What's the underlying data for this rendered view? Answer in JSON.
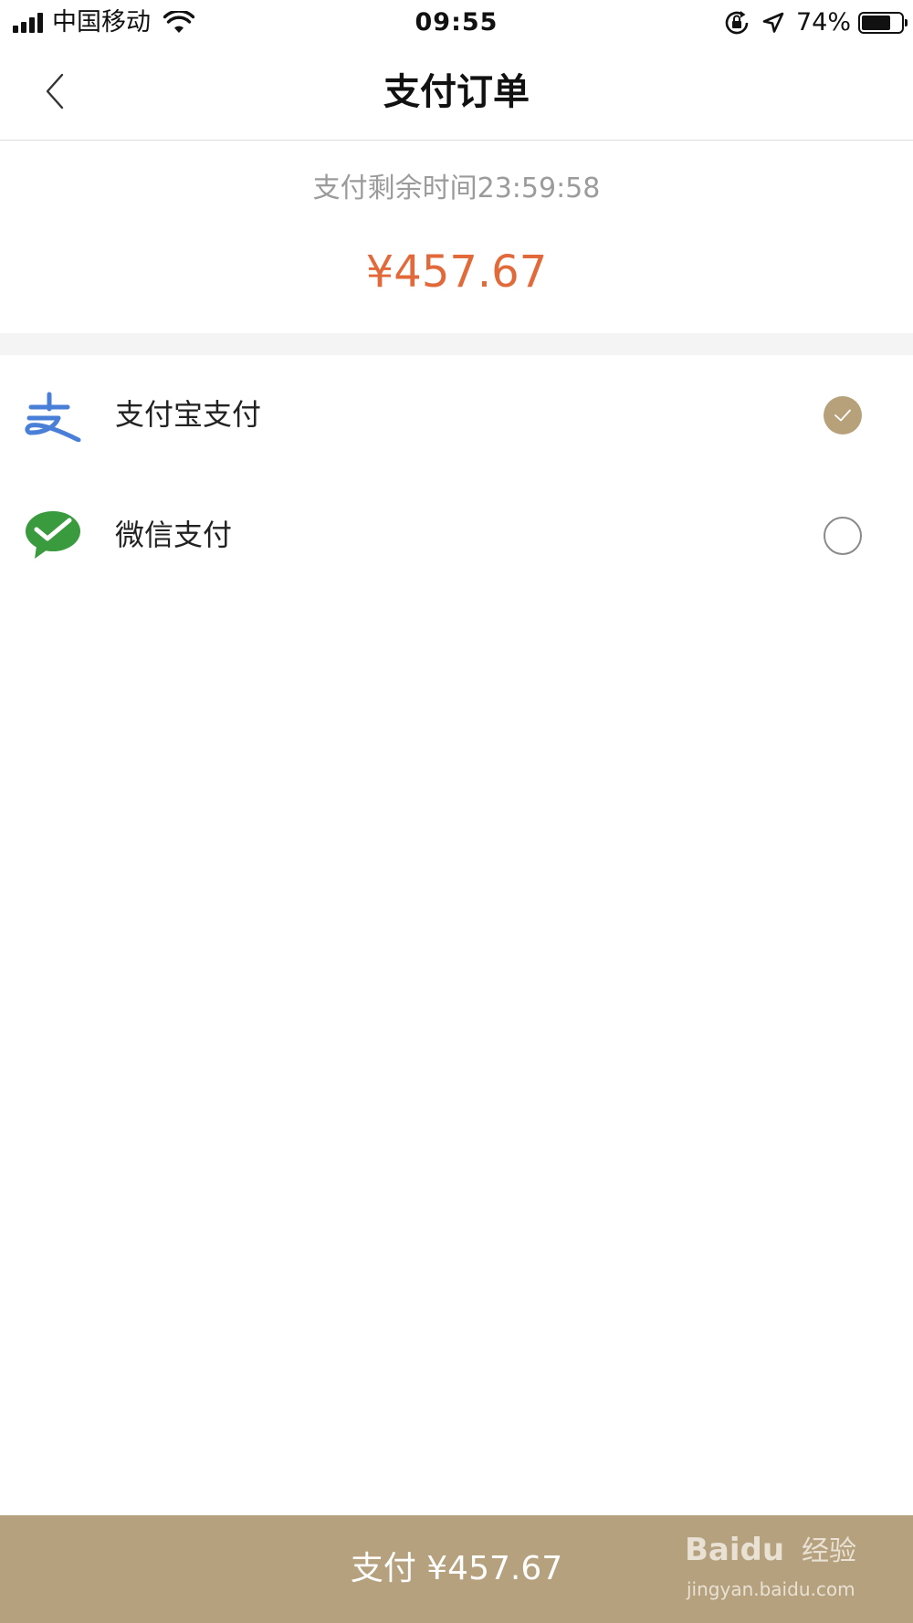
{
  "status_bar": {
    "carrier": "中国移动",
    "time": "09:55",
    "battery_percent_text": "74%",
    "battery_level": 0.74,
    "icons": [
      "signal-icon",
      "wifi-icon",
      "rotation-lock-icon",
      "location-arrow-icon",
      "battery-icon"
    ]
  },
  "nav": {
    "title": "支付订单",
    "back_icon": "chevron-left-icon"
  },
  "order": {
    "countdown": "支付剩余时间23:59:58",
    "amount": "¥457.67"
  },
  "payment_methods": [
    {
      "label": "支付宝支付",
      "icon": "alipay-icon",
      "selected": true
    },
    {
      "label": "微信支付",
      "icon": "wechat-pay-icon",
      "selected": false
    }
  ],
  "pay_button": {
    "label": "支付 ¥457.67"
  },
  "watermark": {
    "brand": "Baidu",
    "brand_cn": "经验",
    "url": "jingyan.baidu.com"
  },
  "colors": {
    "accent": "#b5a17e",
    "amount": "#e2693a",
    "alipay_blue": "#4a7fd8",
    "wechat_green": "#3a9a3e"
  }
}
